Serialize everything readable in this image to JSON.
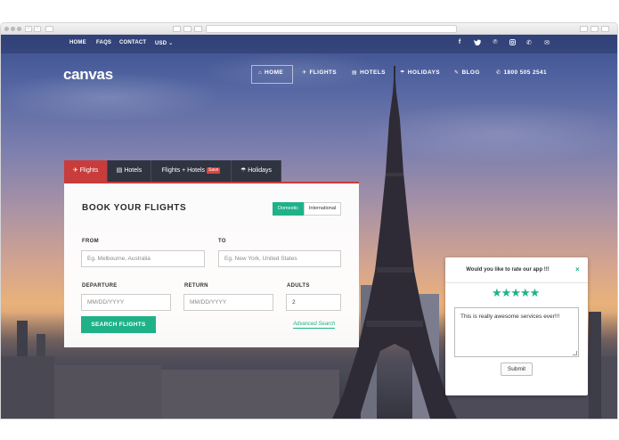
{
  "topbar": {
    "links": [
      "HOME",
      "FAQS",
      "CONTACT",
      "USD ⌄"
    ],
    "social_icons": [
      "facebook-icon",
      "twitter-icon",
      "pinterest-icon",
      "instagram-icon",
      "phone-icon",
      "mail-icon"
    ]
  },
  "header": {
    "logo": "canvas",
    "nav": [
      {
        "label": "HOME",
        "icon": "home-icon"
      },
      {
        "label": "FLIGHTS",
        "icon": "plane-icon"
      },
      {
        "label": "HOTELS",
        "icon": "building-icon"
      },
      {
        "label": "HOLIDAYS",
        "icon": "umbrella-icon"
      },
      {
        "label": "BLOG",
        "icon": "pencil-icon"
      },
      {
        "label": "1800 505 2541",
        "icon": "phone-icon"
      }
    ]
  },
  "booking": {
    "tabs": [
      {
        "label": "Flights",
        "icon": "plane-icon",
        "active": true
      },
      {
        "label": "Hotels",
        "icon": "building-icon",
        "active": false
      },
      {
        "label": "Flights + Hotels",
        "badge": "Save",
        "active": false
      },
      {
        "label": "Holidays",
        "icon": "umbrella-icon",
        "active": false
      }
    ],
    "title": "BOOK YOUR FLIGHTS",
    "trip_toggle": {
      "options": [
        "Domestic",
        "International"
      ],
      "selected": "Domestic"
    },
    "from": {
      "label": "FROM",
      "placeholder": "Eg. Melbourne, Australia"
    },
    "to": {
      "label": "TO",
      "placeholder": "Eg. New York, United States"
    },
    "departure": {
      "label": "DEPARTURE",
      "placeholder": "MM/DD/YYYY"
    },
    "return": {
      "label": "RETURN",
      "placeholder": "MM/DD/YYYY"
    },
    "adults": {
      "label": "ADULTS",
      "value": "2"
    },
    "search_label": "SEARCH FLIGHTS",
    "advanced_label": "Advanced Search"
  },
  "rating": {
    "title": "Would you like to rate our app !!!",
    "close": "×",
    "stars": 5,
    "stars_text": "★★★★★",
    "comment": "This is really awesome services ever!!!",
    "submit_label": "Submit"
  },
  "colors": {
    "accent_green": "#1fb289",
    "tab_red": "#c83c3c",
    "tab_dark": "#2f3440"
  }
}
